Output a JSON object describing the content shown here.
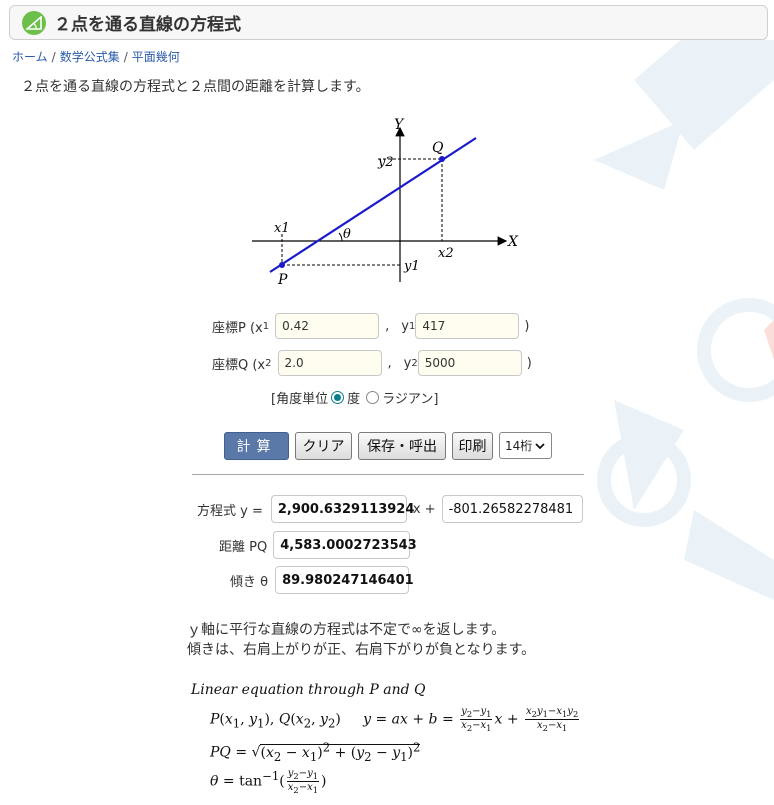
{
  "header": {
    "title": "２点を通る直線の方程式"
  },
  "breadcrumb": [
    "ホーム",
    "数学公式集",
    "平面幾何"
  ],
  "description": "２点を通る直線の方程式と２点間の距離を計算します。",
  "figure": {
    "x_axis": "X",
    "y_axis": "Y",
    "point_p": "P",
    "point_q": "Q",
    "x1": "x1",
    "x2": "x2",
    "y1": "y1",
    "y2": "y2",
    "theta": "θ"
  },
  "inputs": {
    "p_label": "座標P (x",
    "p_sub": "1",
    "p_x1": "0.42",
    "comma1": ",",
    "y_label1": "y",
    "y_sub1": "1",
    "p_y1": "417",
    "close1": ")",
    "q_label": "座標Q (x",
    "q_sub": "2",
    "q_x2": "2.0",
    "comma2": ",",
    "y_label2": "y",
    "y_sub2": "2",
    "q_y2": "5000",
    "close2": ")"
  },
  "angle_unit": {
    "open": "[角度単位",
    "deg": "度",
    "rad": "ラジアン]",
    "selected": "deg"
  },
  "buttons": {
    "calc": "計算",
    "clear": "クリア",
    "save": "保存・呼出",
    "print": "印刷",
    "digits": "14桁"
  },
  "results": {
    "eq_label": "方程式  y =",
    "slope": "2,900.6329113924",
    "x_plus": "x +",
    "intercept": "-801.26582278481",
    "dist_label": "距離 PQ",
    "distance": "4,583.0002723543",
    "angle_label": "傾き θ",
    "angle": "89.980247146401"
  },
  "notes": [
    "ｙ軸に平行な直線の方程式は不定で∞を返します。",
    "傾きは、右肩上がりが正、右肩下がりが負となります。"
  ],
  "formulas": {
    "title": "Linear equation through P and Q"
  },
  "colors": {
    "accent": "#5a78a8",
    "line": "#1a1acc",
    "logo": "#6cc04a",
    "input_bg": "#fffdf0"
  }
}
